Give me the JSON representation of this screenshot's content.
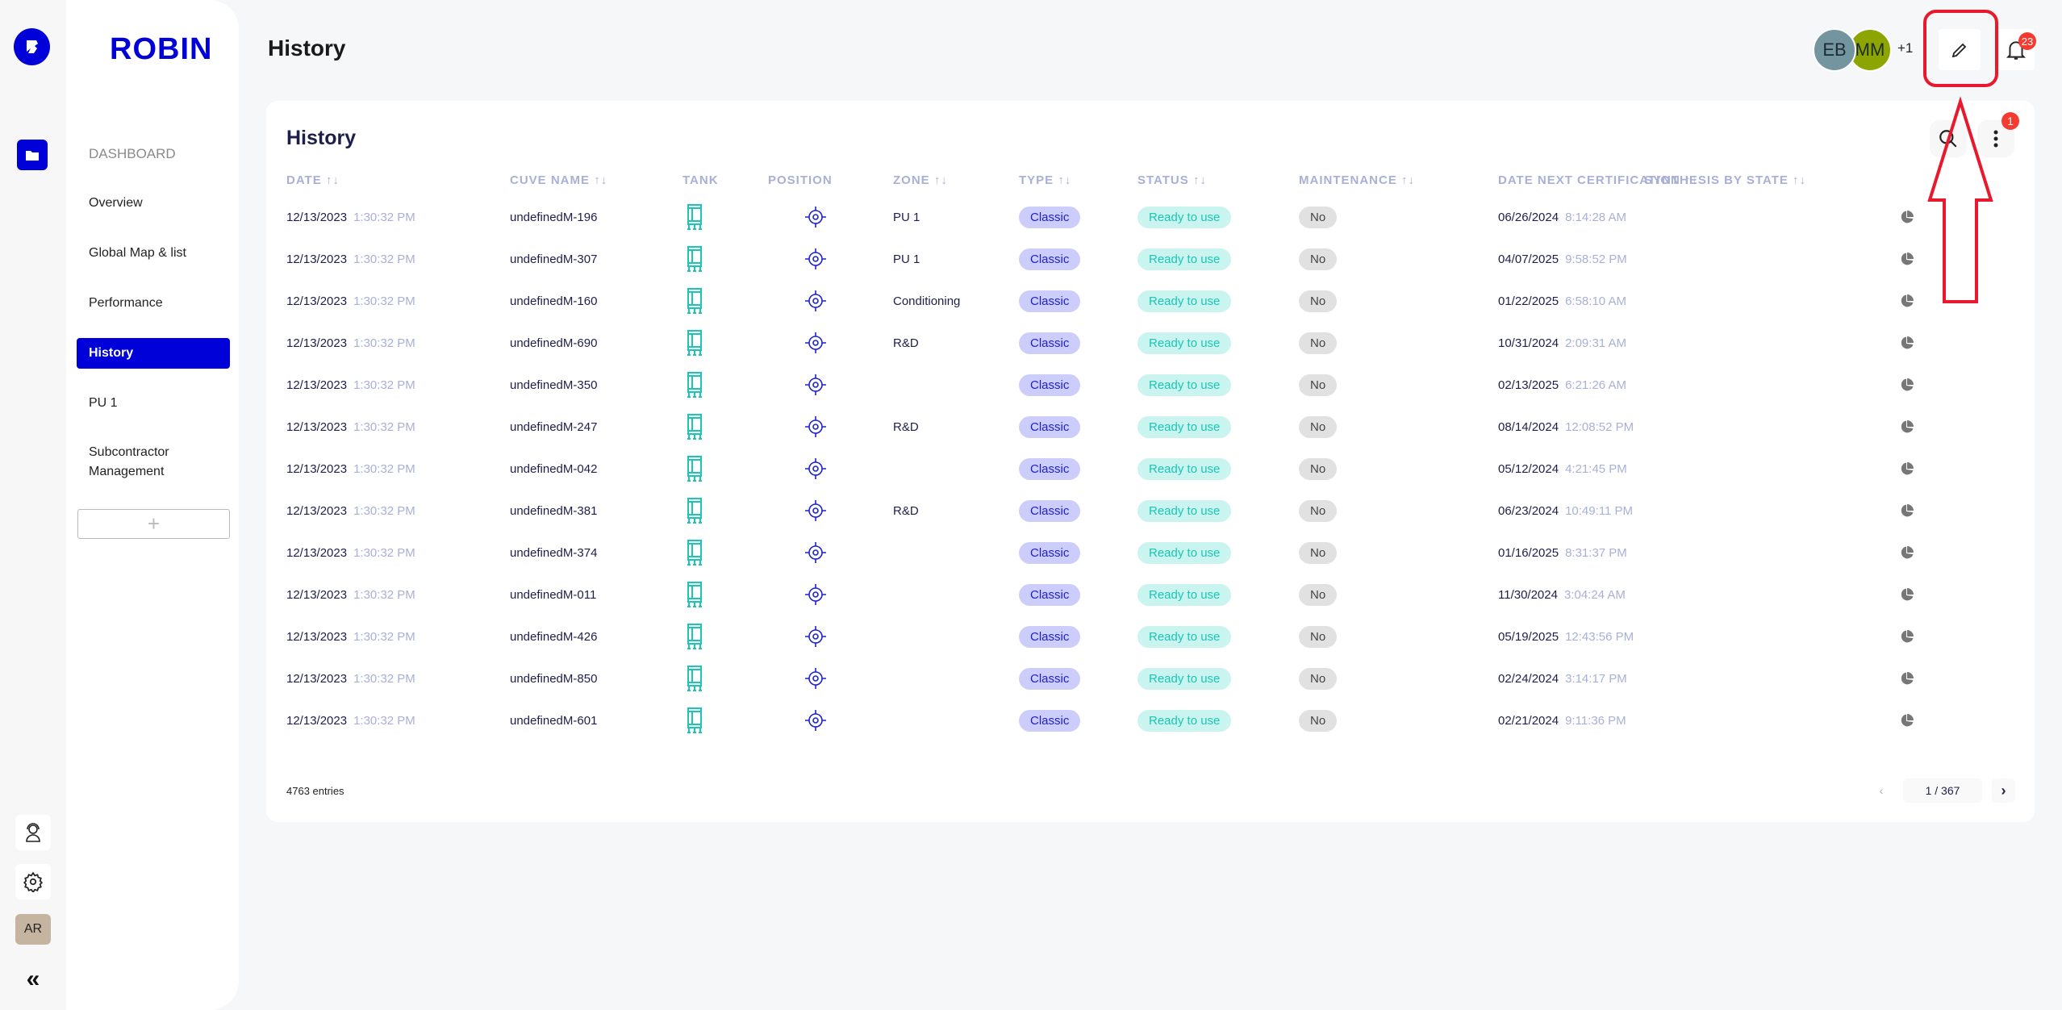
{
  "rail": {
    "avatar_initials": "AR"
  },
  "sidebar": {
    "brand": "ROBIN",
    "section": "DASHBOARD",
    "items": [
      {
        "label": "Overview"
      },
      {
        "label": "Global Map & list"
      },
      {
        "label": "Performance"
      },
      {
        "label": "History",
        "active": true
      },
      {
        "label": "PU 1"
      },
      {
        "label": "Subcontractor Management"
      }
    ],
    "add_label": "+"
  },
  "header": {
    "title": "History",
    "users": [
      {
        "initials": "EB",
        "color": "#73959f"
      },
      {
        "initials": "MM",
        "color": "#8ca500"
      }
    ],
    "more_users": "+1",
    "notification_count": "23"
  },
  "card": {
    "title": "History",
    "filter_badge": "1",
    "columns": [
      "DATE",
      "CUVE NAME",
      "TANK",
      "POSITION",
      "ZONE",
      "TYPE",
      "STATUS",
      "MAINTENANCE",
      "DATE NEXT CERTIFICATION",
      "SYNTHESIS BY STATE"
    ],
    "sort_icon": "↑↓",
    "rows": [
      {
        "date": "12/13/2023",
        "time": "1:30:32 PM",
        "name": "undefinedM-196",
        "zone": "PU 1",
        "type": "Classic",
        "status": "Ready to use",
        "maintenance": "No",
        "cert_date": "06/26/2024",
        "cert_time": "8:14:28 AM"
      },
      {
        "date": "12/13/2023",
        "time": "1:30:32 PM",
        "name": "undefinedM-307",
        "zone": "PU 1",
        "type": "Classic",
        "status": "Ready to use",
        "maintenance": "No",
        "cert_date": "04/07/2025",
        "cert_time": "9:58:52 PM"
      },
      {
        "date": "12/13/2023",
        "time": "1:30:32 PM",
        "name": "undefinedM-160",
        "zone": "Conditioning",
        "type": "Classic",
        "status": "Ready to use",
        "maintenance": "No",
        "cert_date": "01/22/2025",
        "cert_time": "6:58:10 AM"
      },
      {
        "date": "12/13/2023",
        "time": "1:30:32 PM",
        "name": "undefinedM-690",
        "zone": "R&D",
        "type": "Classic",
        "status": "Ready to use",
        "maintenance": "No",
        "cert_date": "10/31/2024",
        "cert_time": "2:09:31 AM"
      },
      {
        "date": "12/13/2023",
        "time": "1:30:32 PM",
        "name": "undefinedM-350",
        "zone": "",
        "type": "Classic",
        "status": "Ready to use",
        "maintenance": "No",
        "cert_date": "02/13/2025",
        "cert_time": "6:21:26 AM"
      },
      {
        "date": "12/13/2023",
        "time": "1:30:32 PM",
        "name": "undefinedM-247",
        "zone": "R&D",
        "type": "Classic",
        "status": "Ready to use",
        "maintenance": "No",
        "cert_date": "08/14/2024",
        "cert_time": "12:08:52 PM"
      },
      {
        "date": "12/13/2023",
        "time": "1:30:32 PM",
        "name": "undefinedM-042",
        "zone": "",
        "type": "Classic",
        "status": "Ready to use",
        "maintenance": "No",
        "cert_date": "05/12/2024",
        "cert_time": "4:21:45 PM"
      },
      {
        "date": "12/13/2023",
        "time": "1:30:32 PM",
        "name": "undefinedM-381",
        "zone": "R&D",
        "type": "Classic",
        "status": "Ready to use",
        "maintenance": "No",
        "cert_date": "06/23/2024",
        "cert_time": "10:49:11 PM"
      },
      {
        "date": "12/13/2023",
        "time": "1:30:32 PM",
        "name": "undefinedM-374",
        "zone": "",
        "type": "Classic",
        "status": "Ready to use",
        "maintenance": "No",
        "cert_date": "01/16/2025",
        "cert_time": "8:31:37 PM"
      },
      {
        "date": "12/13/2023",
        "time": "1:30:32 PM",
        "name": "undefinedM-011",
        "zone": "",
        "type": "Classic",
        "status": "Ready to use",
        "maintenance": "No",
        "cert_date": "11/30/2024",
        "cert_time": "3:04:24 AM"
      },
      {
        "date": "12/13/2023",
        "time": "1:30:32 PM",
        "name": "undefinedM-426",
        "zone": "",
        "type": "Classic",
        "status": "Ready to use",
        "maintenance": "No",
        "cert_date": "05/19/2025",
        "cert_time": "12:43:56 PM"
      },
      {
        "date": "12/13/2023",
        "time": "1:30:32 PM",
        "name": "undefinedM-850",
        "zone": "",
        "type": "Classic",
        "status": "Ready to use",
        "maintenance": "No",
        "cert_date": "02/24/2024",
        "cert_time": "3:14:17 PM"
      },
      {
        "date": "12/13/2023",
        "time": "1:30:32 PM",
        "name": "undefinedM-601",
        "zone": "",
        "type": "Classic",
        "status": "Ready to use",
        "maintenance": "No",
        "cert_date": "02/21/2024",
        "cert_time": "9:11:36 PM"
      }
    ],
    "entries": "4763 entries",
    "page": "1 / 367"
  },
  "colors": {
    "brand": "#0000d8",
    "tank": "#1cc6b4",
    "annotation": "#e8192c"
  }
}
